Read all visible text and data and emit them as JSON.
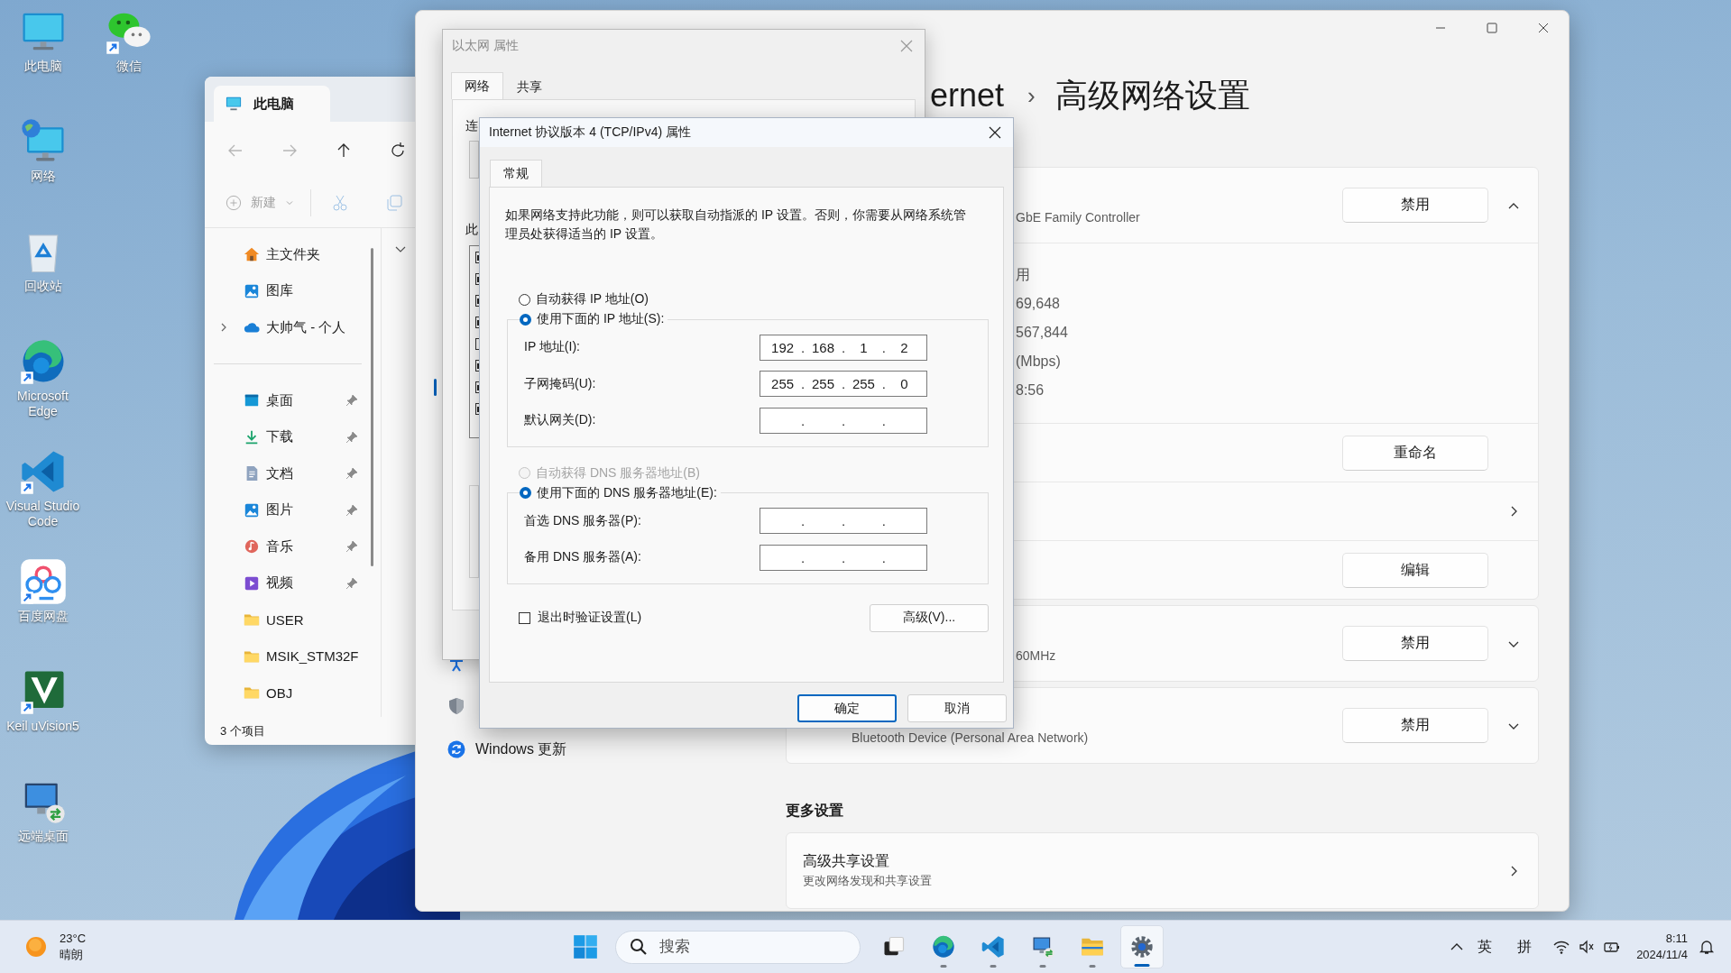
{
  "desktop_icons": [
    {
      "label": "此电脑",
      "kind": "computer"
    },
    {
      "label": "微信",
      "kind": "wechat"
    },
    {
      "label": "网络",
      "kind": "network"
    },
    {
      "label": "回收站",
      "kind": "recycle"
    },
    {
      "label": "Microsoft Edge",
      "kind": "edge"
    },
    {
      "label": "Visual Studio Code",
      "kind": "vscode"
    },
    {
      "label": "百度网盘",
      "kind": "baidu"
    },
    {
      "label": "Keil uVision5",
      "kind": "keil"
    },
    {
      "label": "远端桌面",
      "kind": "remote"
    }
  ],
  "explorer": {
    "title": "此电脑",
    "nav_buttons": [
      {
        "kind": "back",
        "disabled": true
      },
      {
        "kind": "forward",
        "disabled": true
      },
      {
        "kind": "up",
        "disabled": false
      },
      {
        "kind": "refresh",
        "disabled": false
      }
    ],
    "toolbar": [
      {
        "kind": "new",
        "label": "新建",
        "disabled": true
      },
      {
        "kind": "cut",
        "disabled": true
      },
      {
        "kind": "copy",
        "disabled": true
      }
    ],
    "sidebar_top": [
      {
        "label": "主文件夹",
        "kind": "home"
      },
      {
        "label": "图库",
        "kind": "gallery"
      },
      {
        "label": "大帅气 - 个人",
        "kind": "cloud",
        "expanded": false
      }
    ],
    "quick_access": [
      {
        "label": "桌面",
        "kind": "desktop",
        "pinned": true
      },
      {
        "label": "下载",
        "kind": "download",
        "pinned": true
      },
      {
        "label": "文档",
        "kind": "document",
        "pinned": true
      },
      {
        "label": "图片",
        "kind": "pictures",
        "pinned": true
      },
      {
        "label": "音乐",
        "kind": "music",
        "pinned": true
      },
      {
        "label": "视频",
        "kind": "video",
        "pinned": true
      },
      {
        "label": "USER",
        "kind": "folder",
        "pinned": false
      },
      {
        "label": "MSIK_STM32F",
        "kind": "folder",
        "pinned": false
      },
      {
        "label": "OBJ",
        "kind": "folder",
        "pinned": false
      }
    ],
    "status": "3 个项目"
  },
  "settings": {
    "breadcrumb_fragment": "ernet",
    "breadcrumb_separator": "›",
    "title": "高级网络设置",
    "nav": [
      {
        "kind": "hidden",
        "selected": true
      },
      {
        "kind": "accessibility",
        "selected": false
      },
      {
        "kind": "shield",
        "selected": false
      },
      {
        "kind": "update",
        "label": "Windows 更新",
        "selected": false
      }
    ],
    "adapters": [
      {
        "description": "GbE Family Controller",
        "button": "禁用",
        "expanded": true,
        "details": [
          "用",
          "69,648",
          "567,844",
          "(Mbps)",
          "8:56"
        ],
        "rows": [
          {
            "kind": "button",
            "button": "重命名"
          },
          {
            "kind": "link"
          },
          {
            "kind": "button",
            "button": "编辑"
          }
        ]
      },
      {
        "description": "60MHz",
        "button": "禁用",
        "expanded": false
      },
      {
        "description": "Bluetooth Device (Personal Area Network)",
        "button": "禁用",
        "expanded": false
      }
    ],
    "more_heading": "更多设置",
    "more_items": [
      {
        "title": "高级共享设置",
        "subtitle": "更改网络发现和共享设置"
      }
    ]
  },
  "ethernet_properties": {
    "title": "以太网 属性",
    "tabs": [
      {
        "label": "网络",
        "selected": true
      },
      {
        "label": "共享",
        "selected": false
      }
    ],
    "connection_label": "连",
    "items_label": "此",
    "components": [
      {
        "checked": true
      },
      {
        "checked": true
      },
      {
        "checked": true
      },
      {
        "checked": true
      },
      {
        "checked": false
      },
      {
        "checked": true
      },
      {
        "checked": true
      },
      {
        "checked": true
      }
    ]
  },
  "ipv4_properties": {
    "title": "Internet 协议版本 4 (TCP/IPv4) 属性",
    "tabs": [
      {
        "label": "常规",
        "selected": true
      }
    ],
    "description": "如果网络支持此功能，则可以获取自动指派的 IP 设置。否则，你需要从网络系统管理员处获得适当的 IP 设置。",
    "ip_options": [
      {
        "label": "自动获得 IP 地址(O)",
        "selected": false,
        "disabled": false
      },
      {
        "label": "使用下面的 IP 地址(S):",
        "selected": true,
        "disabled": false
      }
    ],
    "ip_fields": [
      {
        "label": "IP 地址(I):",
        "octets": [
          "192",
          "168",
          "1",
          "2"
        ]
      },
      {
        "label": "子网掩码(U):",
        "octets": [
          "255",
          "255",
          "255",
          "0"
        ]
      },
      {
        "label": "默认网关(D):"
      }
    ],
    "dns_options": [
      {
        "label": "自动获得 DNS 服务器地址(B)",
        "selected": false,
        "disabled": true
      },
      {
        "label": "使用下面的 DNS 服务器地址(E):",
        "selected": true,
        "disabled": false
      }
    ],
    "dns_fields": [
      {
        "label": "首选 DNS 服务器(P):"
      },
      {
        "label": "备用 DNS 服务器(A):"
      }
    ],
    "octet_separator": ".",
    "validate_checkbox": {
      "label": "退出时验证设置(L)",
      "checked": false
    },
    "advanced_button": "高级(V)...",
    "buttons": [
      {
        "label": "确定",
        "default": true
      },
      {
        "label": "取消",
        "default": false
      }
    ]
  },
  "taskbar": {
    "weather": {
      "temperature": "23°C",
      "condition": "晴朗"
    },
    "search": {
      "placeholder": "搜索"
    },
    "apps": [
      {
        "kind": "task_view",
        "running": false,
        "selected": false
      },
      {
        "kind": "edge",
        "running": true,
        "selected": false
      },
      {
        "kind": "vscode",
        "running": true,
        "selected": false
      },
      {
        "kind": "remote",
        "running": true,
        "selected": false
      },
      {
        "kind": "explorer",
        "running": true,
        "selected": false
      },
      {
        "kind": "settings",
        "running": true,
        "selected": true
      }
    ],
    "tray": {
      "ime_language": "英",
      "ime_mode": "拼",
      "time": "8:11",
      "date": "2024/11/4"
    }
  }
}
